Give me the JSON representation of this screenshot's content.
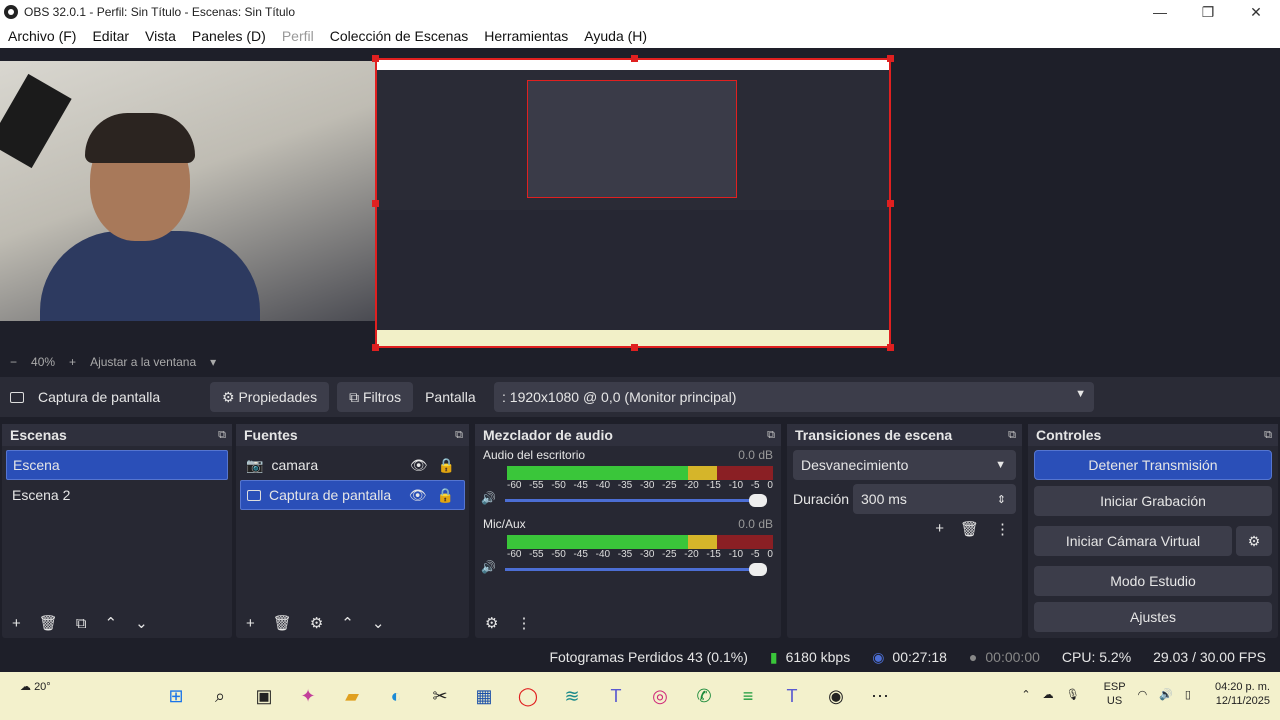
{
  "window": {
    "title": "OBS 32.0.1 - Perfil: Sin Título - Escenas: Sin Título",
    "min": "—",
    "max": "❐",
    "close": "✕"
  },
  "menu": [
    "Archivo (F)",
    "Editar",
    "Vista",
    "Paneles (D)",
    "Perfil",
    "Colección de Escenas",
    "Herramientas",
    "Ayuda (H)"
  ],
  "zoom": {
    "minus": "−",
    "value": "40%",
    "plus": "+",
    "fit": "Ajustar a la ventana",
    "arrow": "▾"
  },
  "source_bar": {
    "selected": "Captura de pantalla",
    "properties": "Propiedades",
    "filters": "Filtros",
    "display_label": "Pantalla",
    "display_value": ": 1920x1080 @ 0,0 (Monitor principal)"
  },
  "scenes": {
    "title": "Escenas",
    "items": [
      "Escena",
      "Escena 2"
    ],
    "selected": 0
  },
  "sources": {
    "title": "Fuentes",
    "items": [
      "camara",
      "Captura de pantalla"
    ],
    "selected": 1
  },
  "mixer": {
    "title": "Mezclador de audio",
    "channels": [
      {
        "name": "Audio del escritorio",
        "db": "0.0 dB"
      },
      {
        "name": "Mic/Aux",
        "db": "0.0 dB"
      }
    ],
    "ticks": [
      "-60",
      "-55",
      "-50",
      "-45",
      "-40",
      "-35",
      "-30",
      "-25",
      "-20",
      "-15",
      "-10",
      "-5",
      "0"
    ]
  },
  "transitions": {
    "title": "Transiciones de escena",
    "type": "Desvanecimiento",
    "duration_label": "Duración",
    "duration_value": "300 ms"
  },
  "controls": {
    "title": "Controles",
    "buttons": [
      "Detener Transmisión",
      "Iniciar Grabación",
      "Iniciar Cámara Virtual",
      "Modo Estudio",
      "Ajustes"
    ]
  },
  "status": {
    "dropped": "Fotogramas Perdidos 43 (0.1%)",
    "kbps": "6180 kbps",
    "stream_time": "00:27:18",
    "rec_time": "00:00:00",
    "cpu": "CPU: 5.2%",
    "fps": "29.03 / 30.00 FPS"
  },
  "taskbar": {
    "weather": "20°",
    "lang1": "ESP",
    "lang2": "US",
    "time": "04:20 p. m.",
    "date": "12/11/2025"
  },
  "colors": {
    "accent": "#2a4fb8",
    "selection_border": "#e02020",
    "taskbar_bg": "#f3f1cc"
  }
}
